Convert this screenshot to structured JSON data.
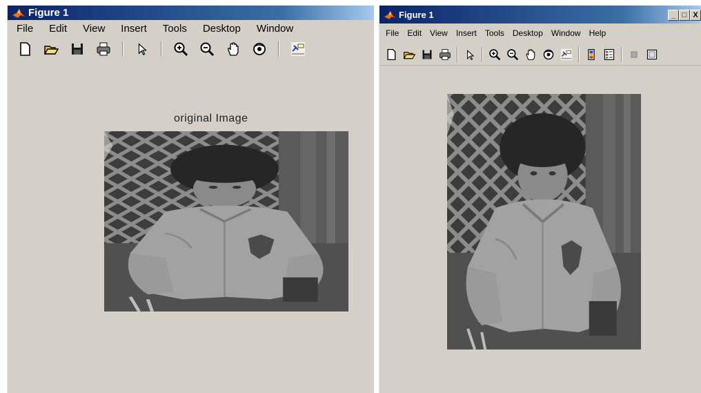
{
  "left_window": {
    "title": "Figure 1",
    "menu": [
      "File",
      "Edit",
      "View",
      "Insert",
      "Tools",
      "Desktop",
      "Window"
    ],
    "axes_title": "original Image",
    "image_alt": "grayscale photo of child in jacket"
  },
  "right_window": {
    "title": "Figure 1",
    "menu": [
      "File",
      "Edit",
      "View",
      "Insert",
      "Tools",
      "Desktop",
      "Window",
      "Help"
    ],
    "window_buttons": [
      "_",
      "□",
      "X"
    ],
    "image_alt": "enhanced grayscale photo of child in jacket"
  },
  "toolbar_icons_left": [
    "new-figure-icon",
    "open-file-icon",
    "save-icon",
    "print-icon",
    "pointer-icon",
    "zoom-in-icon",
    "zoom-out-icon",
    "pan-hand-icon",
    "rotate-3d-icon",
    "data-cursor-icon"
  ],
  "toolbar_icons_right": [
    "new-figure-icon",
    "open-file-icon",
    "save-icon",
    "print-icon",
    "pointer-icon",
    "zoom-in-icon",
    "zoom-out-icon",
    "pan-hand-icon",
    "rotate-3d-icon",
    "data-cursor-icon",
    "colorbar-icon",
    "legend-icon",
    "hide-plot-tools-icon",
    "show-plot-tools-icon"
  ],
  "colors": {
    "titlebar_start": "#0a246a",
    "titlebar_end": "#a6caf0",
    "window_bg": "#d4d0c8",
    "matlab_logo": "#e8741c"
  }
}
